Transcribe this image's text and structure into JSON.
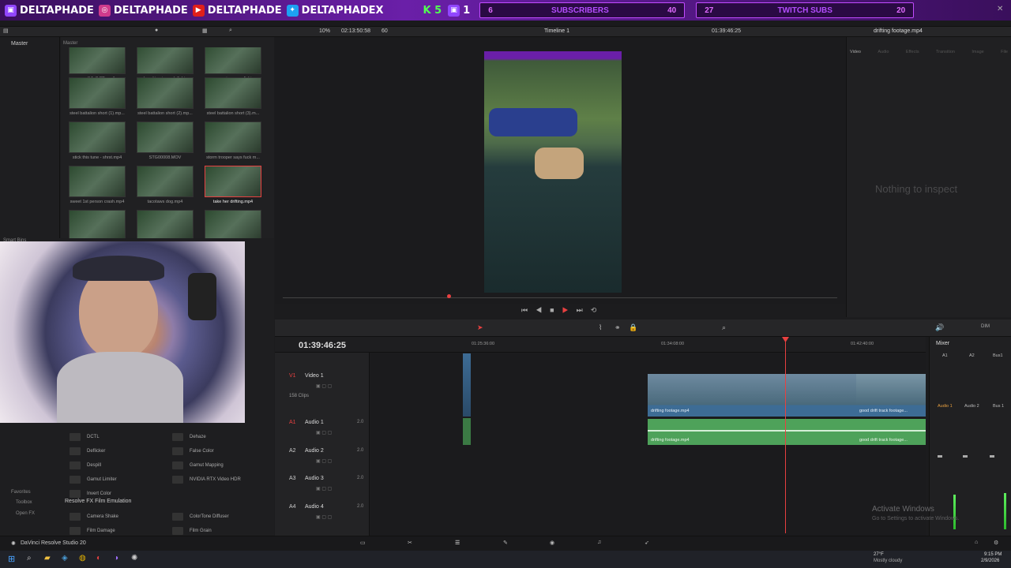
{
  "banner": {
    "handles": [
      "DELTAPHADE",
      "DELTAPHADE",
      "DELTAPHADE",
      "DELTAPHADEX"
    ],
    "k_value": "K 5",
    "p_value": "1",
    "subs": {
      "left": "6",
      "label": "SUBSCRIBERS",
      "right": "40"
    },
    "twitch": {
      "left": "27",
      "label": "TWITCH SUBS",
      "right": "20"
    }
  },
  "toolbar": {
    "master_left": "Master",
    "master_bin": "Master",
    "zoom": "10%",
    "timecode": "02:13:50:58",
    "fps": "60",
    "timeline_name": "Timeline 1",
    "timecode_right": "01:39:46:25",
    "clip_name": "drifting footage.mp4"
  },
  "inspector": {
    "tabs": [
      "Video",
      "Audio",
      "Effects",
      "Transition",
      "Image",
      "File"
    ],
    "empty_text": "Nothing to inspect"
  },
  "media": {
    "clips": [
      {
        "label": "small 1v3 SB.mp4"
      },
      {
        "label": "soul sucking in peak fishing..."
      },
      {
        "label": "space marine seen fishing..."
      },
      {
        "label": "steel battalion short (1).mp..."
      },
      {
        "label": "steel battalion short (2).mp..."
      },
      {
        "label": "steel battalion short (3).m..."
      },
      {
        "label": "stick this tune - shrst.mp4"
      },
      {
        "label": "STG00008.MOV"
      },
      {
        "label": "storm trooper says fuck m..."
      },
      {
        "label": "sweet 1st person crash.mp4"
      },
      {
        "label": "tacotaws dog.mp4"
      },
      {
        "label": "take her drifting.mp4"
      }
    ],
    "smart_bins": "Smart Bins"
  },
  "effects": {
    "items_left": [
      "DCTL",
      "Deflicker",
      "Despill",
      "Gamut Limiter",
      "Invert Color"
    ],
    "items_right": [
      "Dehaze",
      "False Color",
      "Gamut Mapping",
      "NVIDIA RTX Video HDR"
    ],
    "section": "Resolve FX Film Emulation",
    "film_left": [
      "Camera Shake",
      "Film Damage"
    ],
    "film_right": [
      "ColorTone Diffuser",
      "Film Grain"
    ],
    "favorites": "Favorites",
    "fav_items": [
      "Toolbox",
      "Open FX"
    ]
  },
  "timeline": {
    "timecode": "01:39:46:25",
    "ruler": [
      "01:25:36:00",
      "01:34:08:00",
      "01:42:40:00"
    ],
    "tracks": [
      {
        "id": "V1",
        "name": "Video 1",
        "clips": "158 Clips"
      },
      {
        "id": "A1",
        "name": "Audio 1",
        "ch": "2.0"
      },
      {
        "id": "A2",
        "name": "Audio 2",
        "ch": "2.0"
      },
      {
        "id": "A3",
        "name": "Audio 3",
        "ch": "2.0"
      },
      {
        "id": "A4",
        "name": "Audio 4",
        "ch": "2.0"
      }
    ],
    "clip_labels": [
      "drifting footage.mp4",
      "good drift track footage...",
      "drifting footage.mp4",
      "good drift track footage..."
    ]
  },
  "mixer": {
    "title": "Mixer",
    "channels": [
      "A1",
      "A2",
      "Bus1"
    ],
    "strips": [
      "Audio 1",
      "Audio 2",
      "Bus 1"
    ],
    "dim": "DIM"
  },
  "watermark": {
    "title": "Activate Windows",
    "sub": "Go to Settings to activate Windows."
  },
  "app": {
    "name": "DaVinci Resolve Studio 20"
  },
  "taskbar": {
    "temp": "27°F",
    "weather": "Mostly cloudy",
    "time": "9:15 PM",
    "date": "2/9/2026"
  },
  "colors": {
    "accent_purple": "#b44dff",
    "playhead": "#e84040",
    "video_clip": "#3d6c95",
    "audio_clip": "#4ea25a"
  }
}
